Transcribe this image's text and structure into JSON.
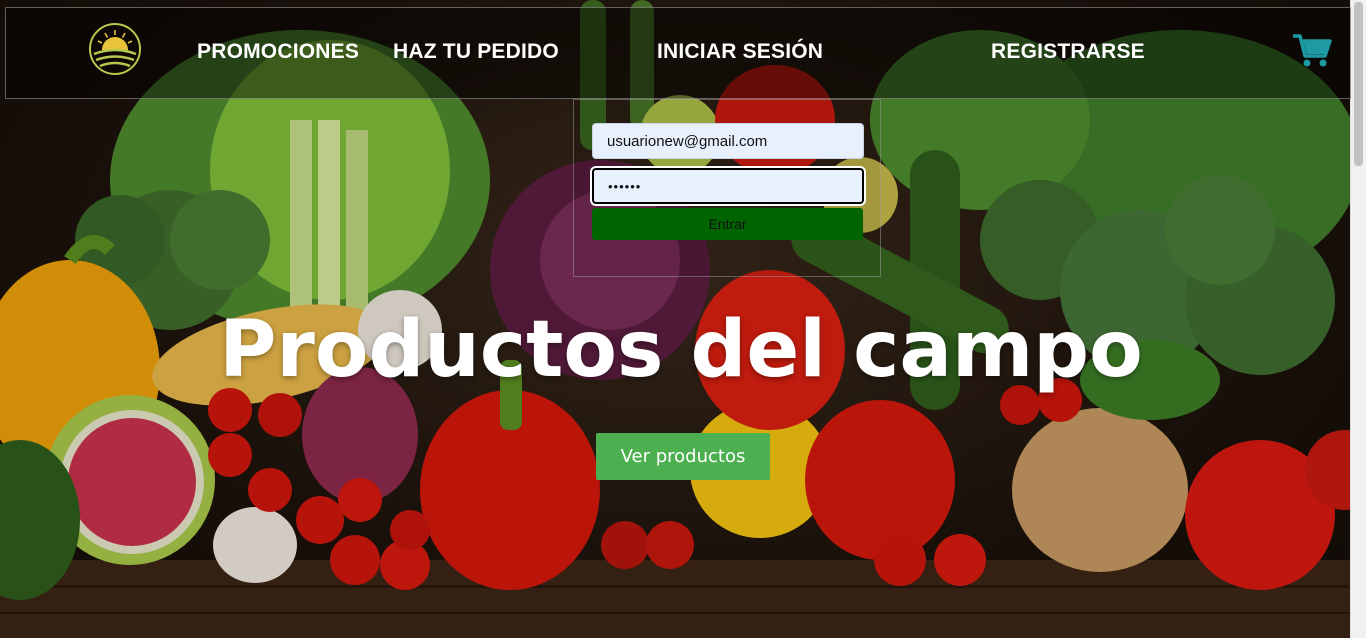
{
  "nav": {
    "links": [
      "PROMOCIONES",
      "HAZ TU PEDIDO",
      "INICIAR SESIÓN",
      "REGISTRARSE"
    ]
  },
  "login": {
    "email_value": "usuarionew@gmail.com",
    "password_value": "••••••",
    "submit_label": "Entrar"
  },
  "hero": {
    "title": "Productos del campo",
    "button_label": "Ver productos"
  },
  "colors": {
    "cart": "#1e9aa3",
    "submit_bg": "#006400",
    "cta_bg": "#4caf50",
    "logo": "#b7c94d"
  },
  "icons": {
    "logo": "sunrise-fields-logo-icon",
    "cart": "shopping-cart-icon"
  }
}
